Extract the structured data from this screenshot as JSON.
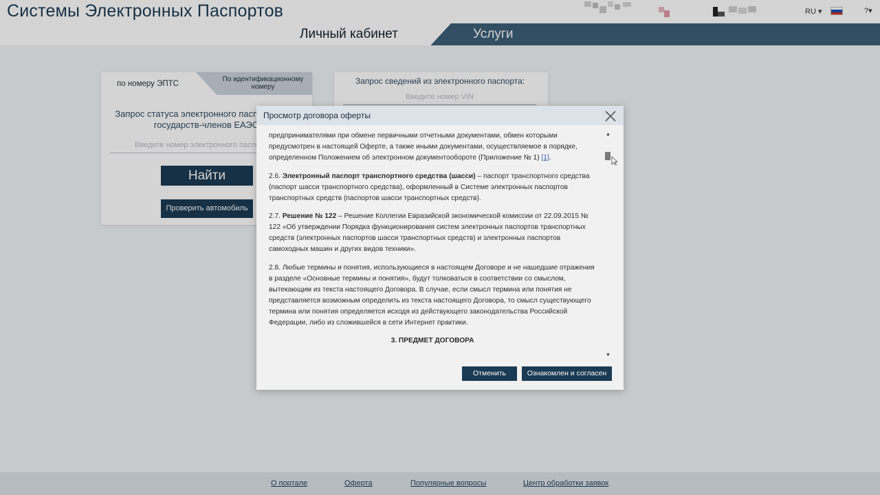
{
  "header": {
    "site_title": "Системы Электронных Паспортов",
    "lang": "RU ▾",
    "help": "?▾"
  },
  "nav": {
    "tabs": [
      {
        "label": "Личный кабинет",
        "active": true
      },
      {
        "label": "Услуги",
        "active": false
      }
    ]
  },
  "left_card": {
    "tab_epts": "по номеру ЭПТС",
    "tab_id": "По идентификационному номеру",
    "text": "Запрос статуса электронного паспорта всех государств-членов ЕАЭС",
    "input_placeholder": "Введите номер электронного паспорта",
    "find_button": "Найти",
    "check_button": "Проверить автомобиль"
  },
  "right_card": {
    "title": "Запрос сведений из электронного паспорта:",
    "input_placeholder": "Введите номер VIN"
  },
  "modal": {
    "title": "Просмотр договора оферты",
    "p0_text": "предпринимателями при обмене первичными отчетными документами, обмен которыми предусмотрен в настоящей Оферте, а также иными документами, осуществляемое в порядке, определенном Положением об электронном документообороте (Приложение № 1) ",
    "p0_link": "[1]",
    "p0_end": ".",
    "p1_num": "2.6. ",
    "p1_term": "Электронный паспорт транспортного средства (шасси)",
    "p1_text": " – паспорт транспортного средства (паспорт шасси транспортного средства), оформленный в Системе электронных паспортов транспортных средств (паспортов шасси транспортных средств).",
    "p2_num": "2.7. ",
    "p2_term": "Решение № 122",
    "p2_text": " – Решение Коллегии Евразийской экономической комиссии от 22.09.2015 № 122 «Об утверждении Порядка функционирования систем электронных паспортов транспортных средств (электронных паспортов шасси транспортных средств) и электронных паспортов самоходных машин и других видов техники».",
    "p3_text": "2.8. Любые термины и понятия, использующиеся в настоящем Договоре и не нашедшие отражения в разделе «Основные термины и понятия», будут толковаться в соответствии со смыслом, вытекающим из текста настоящего Договора. В случае, если смысл термина или понятия не представляется возможным определить из текста настоящего Договора, то смысл существующего термина или понятия определяется исходя из действующего законодательства Российской Федерации, либо из сложившейся в сети Интернет практики.",
    "section_heading": "3. ПРЕДМЕТ ДОГОВОРА",
    "cancel_button": "Отменить",
    "agree_button": "Ознакомлен и согласен"
  },
  "footer": {
    "links": [
      "О портале",
      "Оферта",
      "Популярные вопросы",
      "Центр обработки заявок"
    ]
  },
  "colors": {
    "brand_dark": "#1b3a53",
    "nav_bar": "#3c5e78",
    "link": "#2d5da8"
  }
}
